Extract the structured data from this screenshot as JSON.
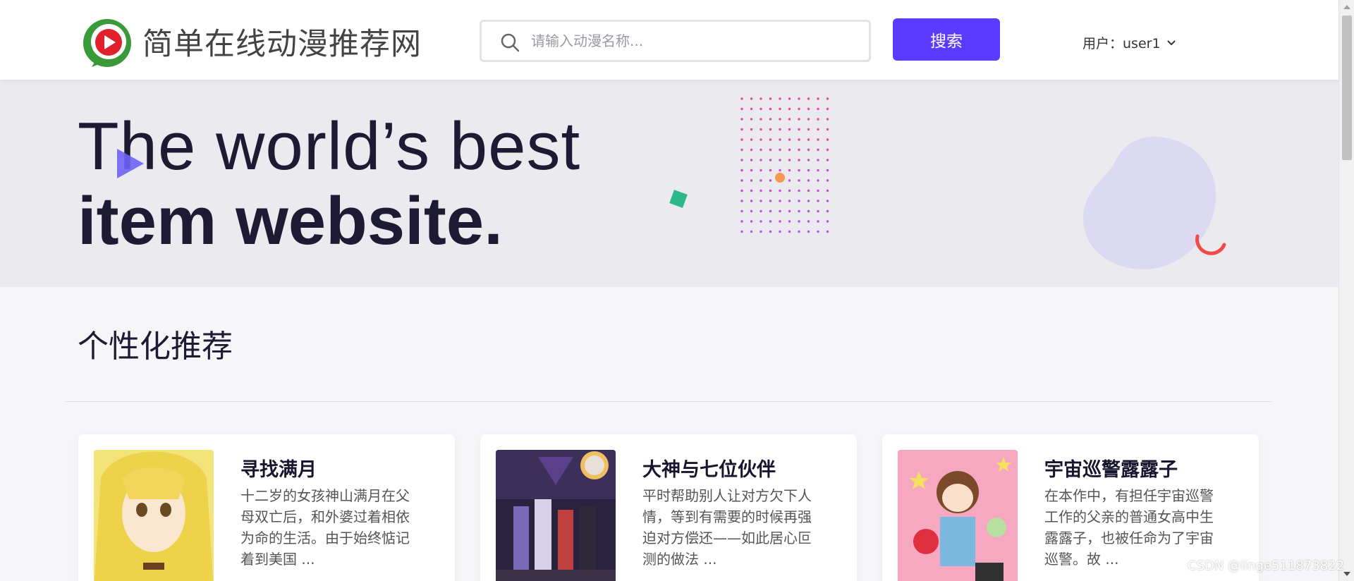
{
  "header": {
    "site_title": "简单在线动漫推荐网",
    "search_placeholder": "请输入动漫名称...",
    "search_button_label": "搜索",
    "user_label": "用户：user1"
  },
  "hero": {
    "line1": "The world’s best",
    "line2": "item website."
  },
  "section": {
    "title": "个性化推荐"
  },
  "cards": [
    {
      "title": "寻找满月",
      "desc": "十二岁的女孩神山满月在父母双亡后，和外婆过着相依为命的生活。由于始终惦记着到美国 ..."
    },
    {
      "title": "大神与七位伙伴",
      "desc": "平时帮助别人让对方欠下人情，等到有需要的时候再强迫对方偿还——如此居心叵测的做法 ..."
    },
    {
      "title": "宇宙巡警露露子",
      "desc": "在本作中，有担任宇宙巡警工作的父亲的普通女高中生露露子，也被任命为了宇宙巡警。故 ..."
    }
  ],
  "watermark": "CSDN @linge511873822",
  "colors": {
    "accent": "#5a3bff",
    "hero_bg": "#ebeaef",
    "page_bg": "#f6f6f9",
    "logo_green": "#3a9a3a",
    "logo_red": "#e0202a"
  }
}
